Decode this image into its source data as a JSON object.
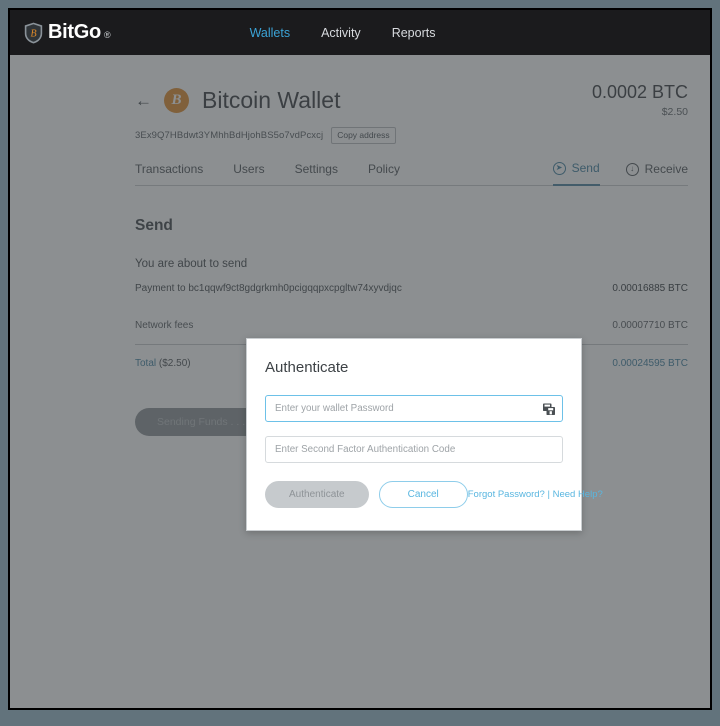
{
  "topnav": {
    "brand": "BitGo",
    "brand_mark": "®",
    "shield_icon": "bitgo-shield-icon",
    "links": [
      {
        "label": "Wallets",
        "active": true
      },
      {
        "label": "Activity",
        "active": false
      },
      {
        "label": "Reports",
        "active": false
      }
    ]
  },
  "wallet": {
    "back_icon": "←",
    "coin_symbol": "B",
    "title": "Bitcoin Wallet",
    "address": "3Ex9Q7HBdwt3YMhhBdHjohBS5o7vdPcxcj",
    "copy_label": "Copy address",
    "balance": "0.0002 BTC",
    "balance_fiat": "$2.50"
  },
  "tabs": [
    {
      "label": "Transactions"
    },
    {
      "label": "Users"
    },
    {
      "label": "Settings"
    },
    {
      "label": "Policy"
    }
  ],
  "action_tabs": [
    {
      "label": "Send",
      "icon": "send-paper-plane-icon",
      "glyph": "➤",
      "active": true
    },
    {
      "label": "Receive",
      "icon": "receive-download-icon",
      "glyph": "↓",
      "active": false
    }
  ],
  "send": {
    "heading": "Send",
    "subheading": "You are about to send",
    "rows": [
      {
        "label": "Payment to bc1qqwf9ct8gdgrkmh0pcigqqpxcpgltw74xyvdjqc",
        "amount": "0.00016885 BTC"
      },
      {
        "label": "Network fees",
        "amount": "0.00007710 BTC"
      }
    ],
    "total": {
      "label_main": "Total",
      "label_fiat": "($2.50)",
      "amount": "0.00024595 BTC"
    },
    "button_label": "Sending Funds . . ."
  },
  "modal": {
    "title": "Authenticate",
    "password_placeholder": "Enter your wallet Password",
    "password_value": "",
    "password_icon": "password-manager-icon",
    "twofa_placeholder": "Enter Second Factor Authentication Code",
    "twofa_value": "",
    "authenticate_label": "Authenticate",
    "cancel_label": "Cancel",
    "forgot_label": "Forgot Password?",
    "link_separator": "|",
    "help_label": "Need Help?"
  },
  "colors": {
    "accent_blue": "#59b6e0",
    "nav_active": "#3ba3d6",
    "btc_orange": "#e08a28",
    "topnav_bg": "#1b1b1d"
  }
}
